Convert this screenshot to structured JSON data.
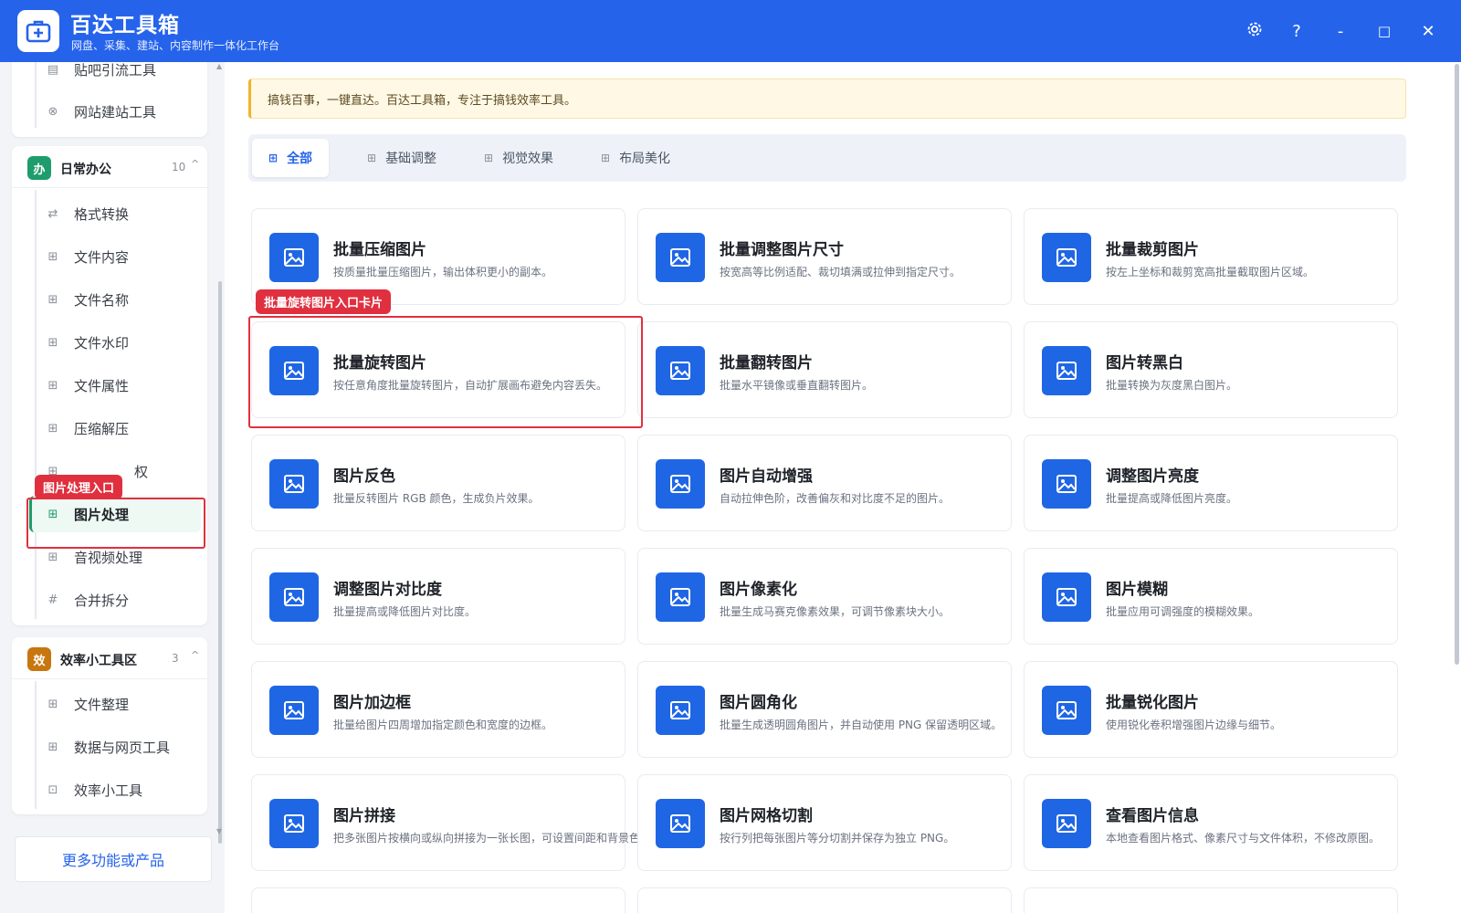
{
  "app": {
    "name": "百达工具箱",
    "subtitle": "网盘、采集、建站、内容制作一体化工作台"
  },
  "window_controls": {
    "settings_icon": "gear-icon",
    "help": "?",
    "minimize": "-",
    "maximize": "□",
    "close": "✕"
  },
  "sidebar": {
    "top_group": {
      "items": [
        {
          "label": "贴吧引流工具",
          "icon": "doc-icon"
        },
        {
          "label": "网站建站工具",
          "icon": "globe-icon"
        }
      ]
    },
    "office_group": {
      "badge": "办",
      "title": "日常办公",
      "count": "10",
      "caret": "^",
      "badge_color": "#1f9c6b",
      "items": [
        {
          "label": "格式转换",
          "icon": "swap-icon"
        },
        {
          "label": "文件内容",
          "icon": "grid-icon"
        },
        {
          "label": "文件名称",
          "icon": "grid-icon"
        },
        {
          "label": "文件水印",
          "icon": "grid-icon"
        },
        {
          "label": "文件属性",
          "icon": "grid-icon"
        },
        {
          "label": "压缩解压",
          "icon": "grid-icon"
        },
        {
          "label": "权",
          "icon": "grid-icon"
        },
        {
          "label": "图片处理",
          "icon": "grid-icon",
          "active": true
        },
        {
          "label": "音视频处理",
          "icon": "grid-icon"
        },
        {
          "label": "合并拆分",
          "icon": "hash-icon"
        }
      ]
    },
    "efficiency_group": {
      "badge": "效",
      "title": "效率小工具区",
      "count": "3",
      "caret": "^",
      "badge_color": "#c8760f",
      "items": [
        {
          "label": "文件整理",
          "icon": "grid-icon"
        },
        {
          "label": "数据与网页工具",
          "icon": "grid-icon"
        },
        {
          "label": "效率小工具",
          "icon": "box-icon"
        }
      ]
    },
    "more_button": "更多功能或产品"
  },
  "main": {
    "notice": "搞钱百事，一键直达。百达工具箱，专注于搞钱效率工具。",
    "tabs": [
      {
        "label": "全部",
        "active": true
      },
      {
        "label": "基础调整"
      },
      {
        "label": "视觉效果"
      },
      {
        "label": "布局美化"
      }
    ],
    "cards": [
      {
        "title": "批量压缩图片",
        "desc": "按质量批量压缩图片，输出体积更小的副本。"
      },
      {
        "title": "批量调整图片尺寸",
        "desc": "按宽高等比例适配、裁切填满或拉伸到指定尺寸。"
      },
      {
        "title": "批量裁剪图片",
        "desc": "按左上坐标和裁剪宽高批量截取图片区域。"
      },
      {
        "title": "批量旋转图片",
        "desc": "按任意角度批量旋转图片，自动扩展画布避免内容丢失。"
      },
      {
        "title": "批量翻转图片",
        "desc": "批量水平镜像或垂直翻转图片。"
      },
      {
        "title": "图片转黑白",
        "desc": "批量转换为灰度黑白图片。"
      },
      {
        "title": "图片反色",
        "desc": "批量反转图片 RGB 颜色，生成负片效果。"
      },
      {
        "title": "图片自动增强",
        "desc": "自动拉伸色阶，改善偏灰和对比度不足的图片。"
      },
      {
        "title": "调整图片亮度",
        "desc": "批量提高或降低图片亮度。"
      },
      {
        "title": "调整图片对比度",
        "desc": "批量提高或降低图片对比度。"
      },
      {
        "title": "图片像素化",
        "desc": "批量生成马赛克像素效果，可调节像素块大小。"
      },
      {
        "title": "图片模糊",
        "desc": "批量应用可调强度的模糊效果。"
      },
      {
        "title": "图片加边框",
        "desc": "批量给图片四周增加指定颜色和宽度的边框。"
      },
      {
        "title": "图片圆角化",
        "desc": "批量生成透明圆角图片，并自动使用 PNG 保留透明区域。"
      },
      {
        "title": "批量锐化图片",
        "desc": "使用锐化卷积增强图片边缘与细节。"
      },
      {
        "title": "图片拼接",
        "desc": "把多张图片按横向或纵向拼接为一张长图，可设置间距和背景色。"
      },
      {
        "title": "图片网格切割",
        "desc": "按行列把每张图片等分切割并保存为独立 PNG。"
      },
      {
        "title": "查看图片信息",
        "desc": "本地查看图片格式、像素尺寸与文件体积，不修改原图。"
      }
    ]
  },
  "annotations": {
    "rotate_card": "批量旋转图片入口卡片",
    "image_nav": "图片处理入口"
  },
  "colors": {
    "brand": "#2563eb",
    "card_icon": "#1f66e5",
    "active_green": "#1f9c6b",
    "highlight": "#e0303f"
  }
}
